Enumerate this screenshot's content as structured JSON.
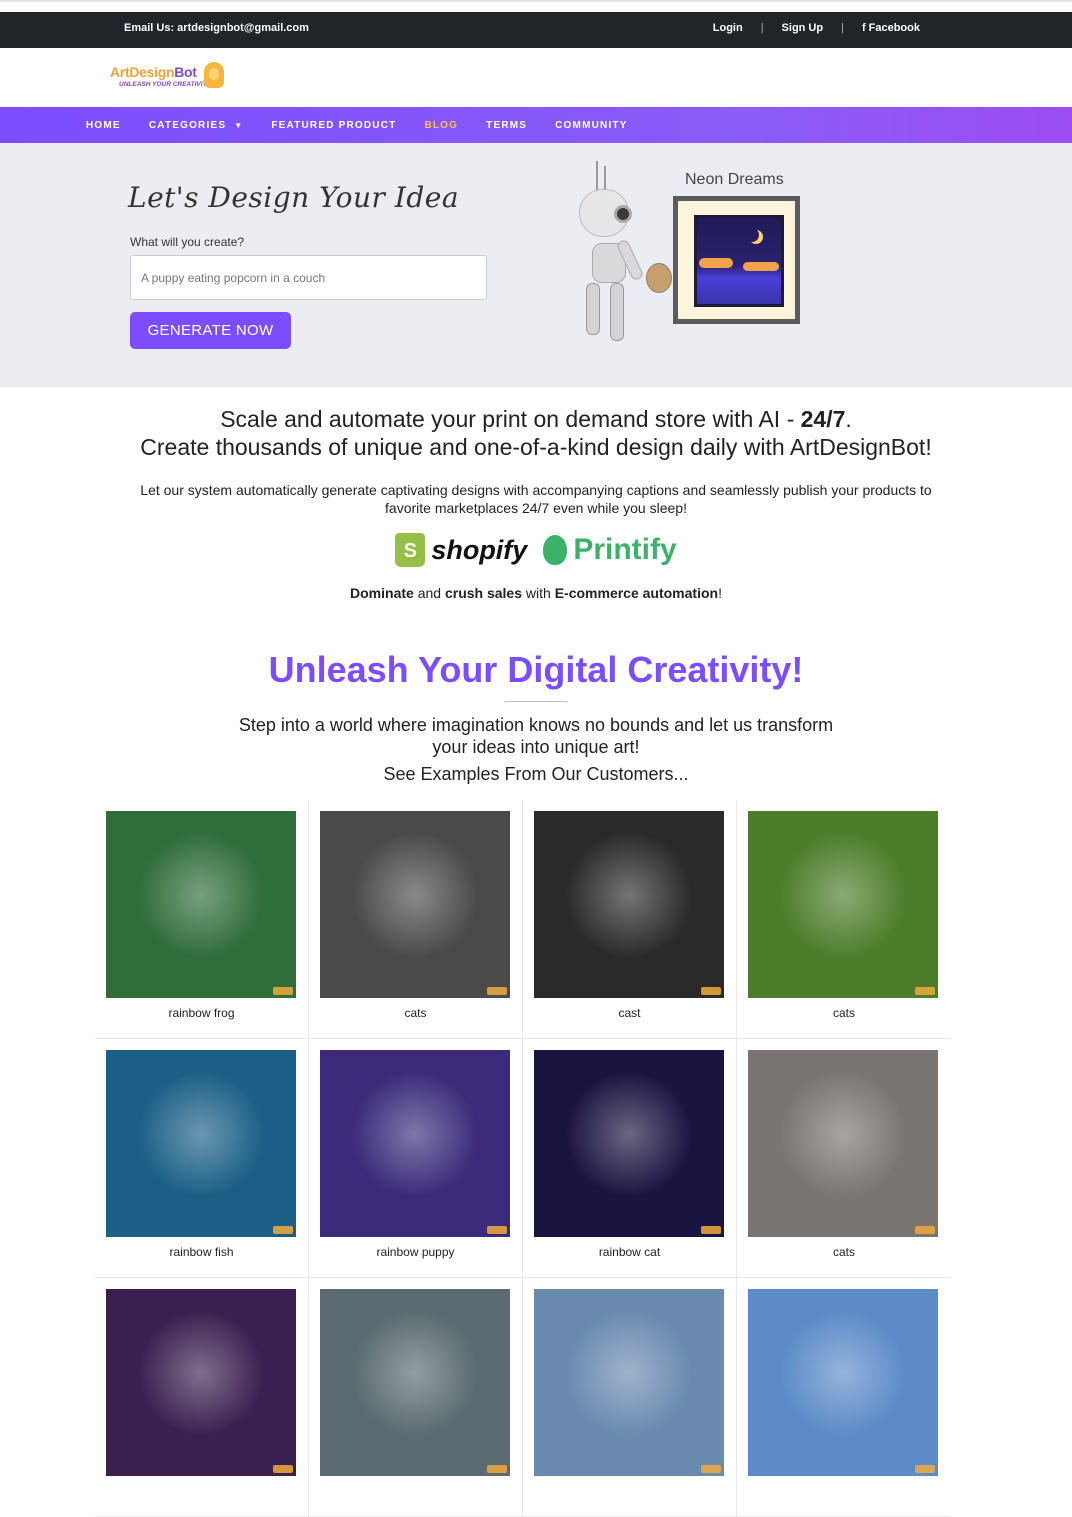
{
  "topbar": {
    "email": "Email Us: artdesignbot@gmail.com",
    "login": "Login",
    "signup": "Sign Up",
    "facebook": "Facebook",
    "separator": "|"
  },
  "logo": {
    "name_part1": "ArtDesign",
    "name_part2": "Bot",
    "tagline": "UNLEASH YOUR CREATIVITY"
  },
  "nav": {
    "items": [
      {
        "label": "HOME"
      },
      {
        "label": "CATEGORIES"
      },
      {
        "label": "FEATURED PRODUCT"
      },
      {
        "label": "BLOG"
      },
      {
        "label": "TERMS"
      },
      {
        "label": "COMMUNITY"
      }
    ],
    "active": "BLOG"
  },
  "hero": {
    "title": "Let's Design Your Idea",
    "question": "What will you create?",
    "placeholder": "A puppy eating popcorn in a couch",
    "button": "GENERATE NOW",
    "art_label": "Neon Dreams"
  },
  "intro": {
    "line1_a": "Scale and automate your print on demand store with AI - ",
    "line1_b": "24/7",
    "line1_c": ".",
    "line2": "Create thousands of unique and one-of-a-kind design daily with ArtDesignBot!",
    "sub": "Let our system automatically generate captivating designs with accompanying captions and seamlessly publish your products to favorite marketplaces 24/7 even while you sleep!",
    "shopify": "shopify",
    "printify": "Printify",
    "dominate_1": "Dominate",
    "dominate_2": " and ",
    "dominate_3": "crush sales",
    "dominate_4": " with ",
    "dominate_5": "E-commerce automation",
    "dominate_6": "!"
  },
  "gallery": {
    "title": "Unleash Your Digital Creativity!",
    "text": "Step into a world where imagination knows no bounds and let us transform your ideas into unique art!",
    "see": "See Examples From Our Customers...",
    "items": [
      {
        "caption": "rainbow frog",
        "color": "#2f6d3a"
      },
      {
        "caption": "cats",
        "color": "#4a4a4a"
      },
      {
        "caption": "cast",
        "color": "#2a2a2a"
      },
      {
        "caption": "cats",
        "color": "#4c7d2a"
      },
      {
        "caption": "rainbow fish",
        "color": "#1b5f86"
      },
      {
        "caption": "rainbow puppy",
        "color": "#3b2b7a"
      },
      {
        "caption": "rainbow cat",
        "color": "#1a1440"
      },
      {
        "caption": "cats",
        "color": "#7a7570"
      },
      {
        "caption": "",
        "color": "#3a2050"
      },
      {
        "caption": "",
        "color": "#5a6a70"
      },
      {
        "caption": "",
        "color": "#6a8ab0"
      },
      {
        "caption": "",
        "color": "#5c8bc8"
      }
    ]
  }
}
